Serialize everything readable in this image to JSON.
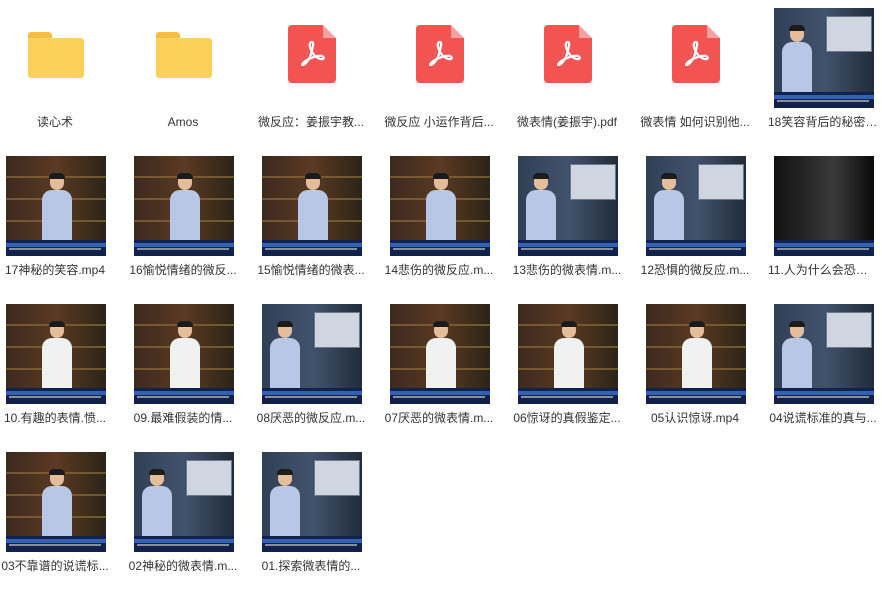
{
  "files": [
    {
      "name": "读心术",
      "type": "folder"
    },
    {
      "name": "Amos",
      "type": "folder"
    },
    {
      "name": "微反应：姜振宇教...",
      "type": "pdf"
    },
    {
      "name": "微反应 小运作背后...",
      "type": "pdf"
    },
    {
      "name": "微表情(姜振宇).pdf",
      "type": "pdf"
    },
    {
      "name": "微表情 如何识别他...",
      "type": "pdf"
    },
    {
      "name": "18笑容背后的秘密....",
      "type": "video",
      "style": "screen"
    },
    {
      "name": "17神秘的笑容.mp4",
      "type": "video",
      "style": "library"
    },
    {
      "name": "16愉悦情绪的微反...",
      "type": "video",
      "style": "library"
    },
    {
      "name": "15愉悦情绪的微表...",
      "type": "video",
      "style": "library"
    },
    {
      "name": "14悲伤的微反应.m...",
      "type": "video",
      "style": "library"
    },
    {
      "name": "13悲伤的微表情.m...",
      "type": "video",
      "style": "screen"
    },
    {
      "name": "12恐惧的微反应.m...",
      "type": "video",
      "style": "screen"
    },
    {
      "name": "11.人为什么会恐惧....",
      "type": "video",
      "style": "dark"
    },
    {
      "name": "10.有趣的表情.愤...",
      "type": "video",
      "style": "library-white"
    },
    {
      "name": "09.最难假装的情...",
      "type": "video",
      "style": "library-white"
    },
    {
      "name": "08厌恶的微反应.m...",
      "type": "video",
      "style": "screen"
    },
    {
      "name": "07厌恶的微表情.m...",
      "type": "video",
      "style": "library-white"
    },
    {
      "name": "06惊讶的真假鉴定...",
      "type": "video",
      "style": "library-white"
    },
    {
      "name": "05认识惊讶.mp4",
      "type": "video",
      "style": "library-white"
    },
    {
      "name": "04说谎标准的真与...",
      "type": "video",
      "style": "screen"
    },
    {
      "name": "03不靠谱的说谎标...",
      "type": "video",
      "style": "library"
    },
    {
      "name": "02神秘的微表情.m...",
      "type": "video",
      "style": "screen"
    },
    {
      "name": "01.探索微表情的...",
      "type": "video",
      "style": "screen"
    }
  ]
}
